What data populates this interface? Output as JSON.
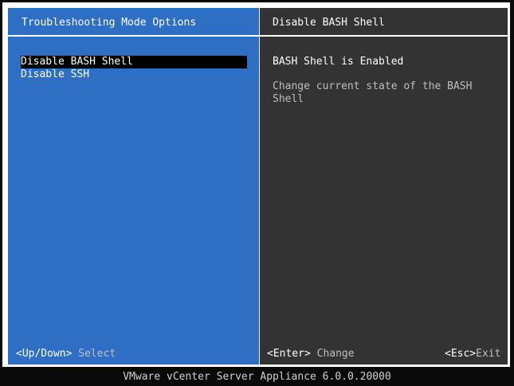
{
  "left_panel": {
    "title": "Troubleshooting Mode Options",
    "menu": [
      {
        "label": "Disable BASH Shell",
        "selected": true
      },
      {
        "label": "Disable SSH",
        "selected": false
      }
    ],
    "hint_key": "<Up/Down>",
    "hint_text": "Select"
  },
  "right_panel": {
    "title": "Disable BASH Shell",
    "status": "BASH Shell is Enabled",
    "description": "Change current state of the BASH Shell",
    "hint_enter_key": "<Enter>",
    "hint_enter_text": "Change",
    "hint_esc_key": "<Esc>",
    "hint_esc_text": "Exit"
  },
  "footer": {
    "text": "VMware vCenter Server Appliance 6.0.0.20000"
  },
  "colors": {
    "left_bg": "#2f6fc3",
    "right_bg": "#333333",
    "selection_bg": "#000000"
  }
}
